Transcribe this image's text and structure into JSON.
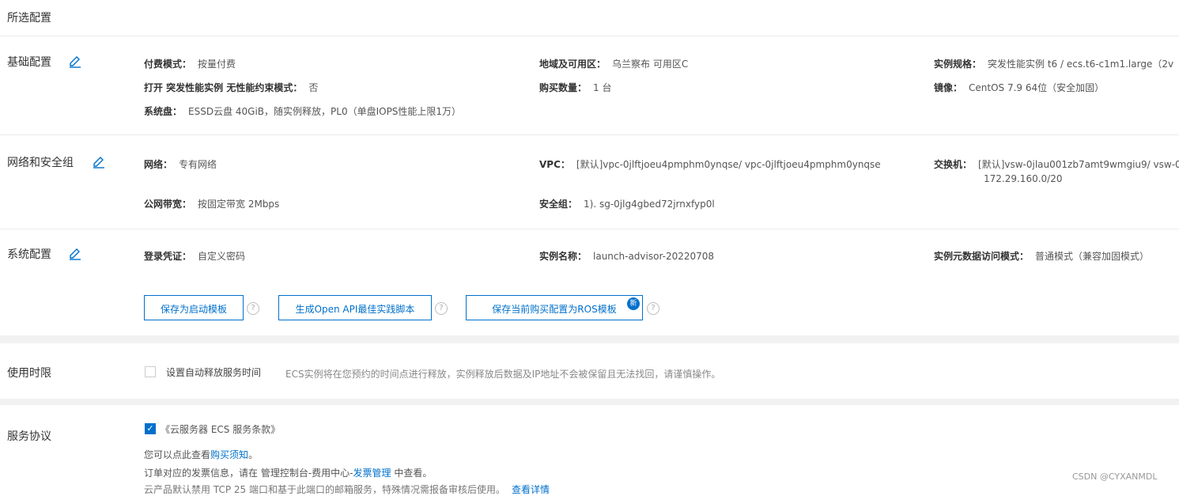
{
  "header": {
    "title": "所选配置"
  },
  "basic": {
    "title": "基础配置",
    "fields": [
      {
        "label": "付费模式：",
        "value": "按量付费"
      },
      {
        "label": "地域及可用区：",
        "value": "乌兰察布 可用区C"
      },
      {
        "label": "实例规格：",
        "value": "突发性能实例 t6 / ecs.t6-c1m1.large（2v"
      },
      {
        "label": "打开 突发性能实例 无性能约束模式：",
        "value": "否"
      },
      {
        "label": "购买数量：",
        "value": "1 台"
      },
      {
        "label": "镜像：",
        "value": "CentOS 7.9 64位（安全加固）"
      },
      {
        "label": "系统盘：",
        "value": "ESSD云盘 40GiB，随实例释放，PL0（单盘IOPS性能上限1万）"
      }
    ]
  },
  "network": {
    "title": "网络和安全组",
    "fields": [
      {
        "label": "网络：",
        "value": "专有网络"
      },
      {
        "label": "VPC：",
        "value": "[默认]vpc-0jlftjoeu4pmphm0ynqse/ vpc-0jlftjoeu4pmphm0ynqse"
      },
      {
        "label": "交换机：",
        "value": "[默认]vsw-0jlau001zb7amt9wmgiu9/ vsw-0j",
        "value2": "172.29.160.0/20"
      },
      {
        "label": "公网带宽：",
        "value": "按固定带宽 2Mbps"
      },
      {
        "label": "安全组：",
        "value": "1). sg-0jlg4gbed72jrnxfyp0l"
      }
    ]
  },
  "system": {
    "title": "系统配置",
    "fields": [
      {
        "label": "登录凭证：",
        "value": "自定义密码"
      },
      {
        "label": "实例名称：",
        "value": "launch-advisor-20220708"
      },
      {
        "label": "实例元数据访问模式：",
        "value": "普通模式（兼容加固模式）"
      }
    ]
  },
  "buttons": {
    "save_template": "保存为启动模板",
    "gen_openapi": "生成Open API最佳实践脚本",
    "save_ros": "保存当前购买配置为ROS模板",
    "help_glyph": "?",
    "ros_badge": "新"
  },
  "usage": {
    "title": "使用时限",
    "checkbox_label": "设置自动释放服务时间",
    "desc": "ECS实例将在您预约的时间点进行释放，实例释放后数据及IP地址不会被保留且无法找回，请谨慎操作。"
  },
  "agreement": {
    "title": "服务协议",
    "check_mark": "✓",
    "terms_link": "《云服务器 ECS 服务条款》",
    "line1_prefix": "您可以点此查看",
    "line1_link": "购买须知",
    "line1_suffix": "。",
    "line2_prefix": "订单对应的发票信息，请在 管理控制台-费用中心-",
    "line2_link": "发票管理",
    "line2_suffix": " 中查看。",
    "line3_partial": "云产品默认禁用 TCP 25 端口和基于此端口的邮箱服务，特殊情况需报备审核后使用。",
    "line3_link": "查看详情"
  },
  "watermark": "CSDN @CYXANMDL",
  "colors": {
    "accent": "#0070cc",
    "band": "#f2f2f2",
    "divider": "#ececec"
  }
}
